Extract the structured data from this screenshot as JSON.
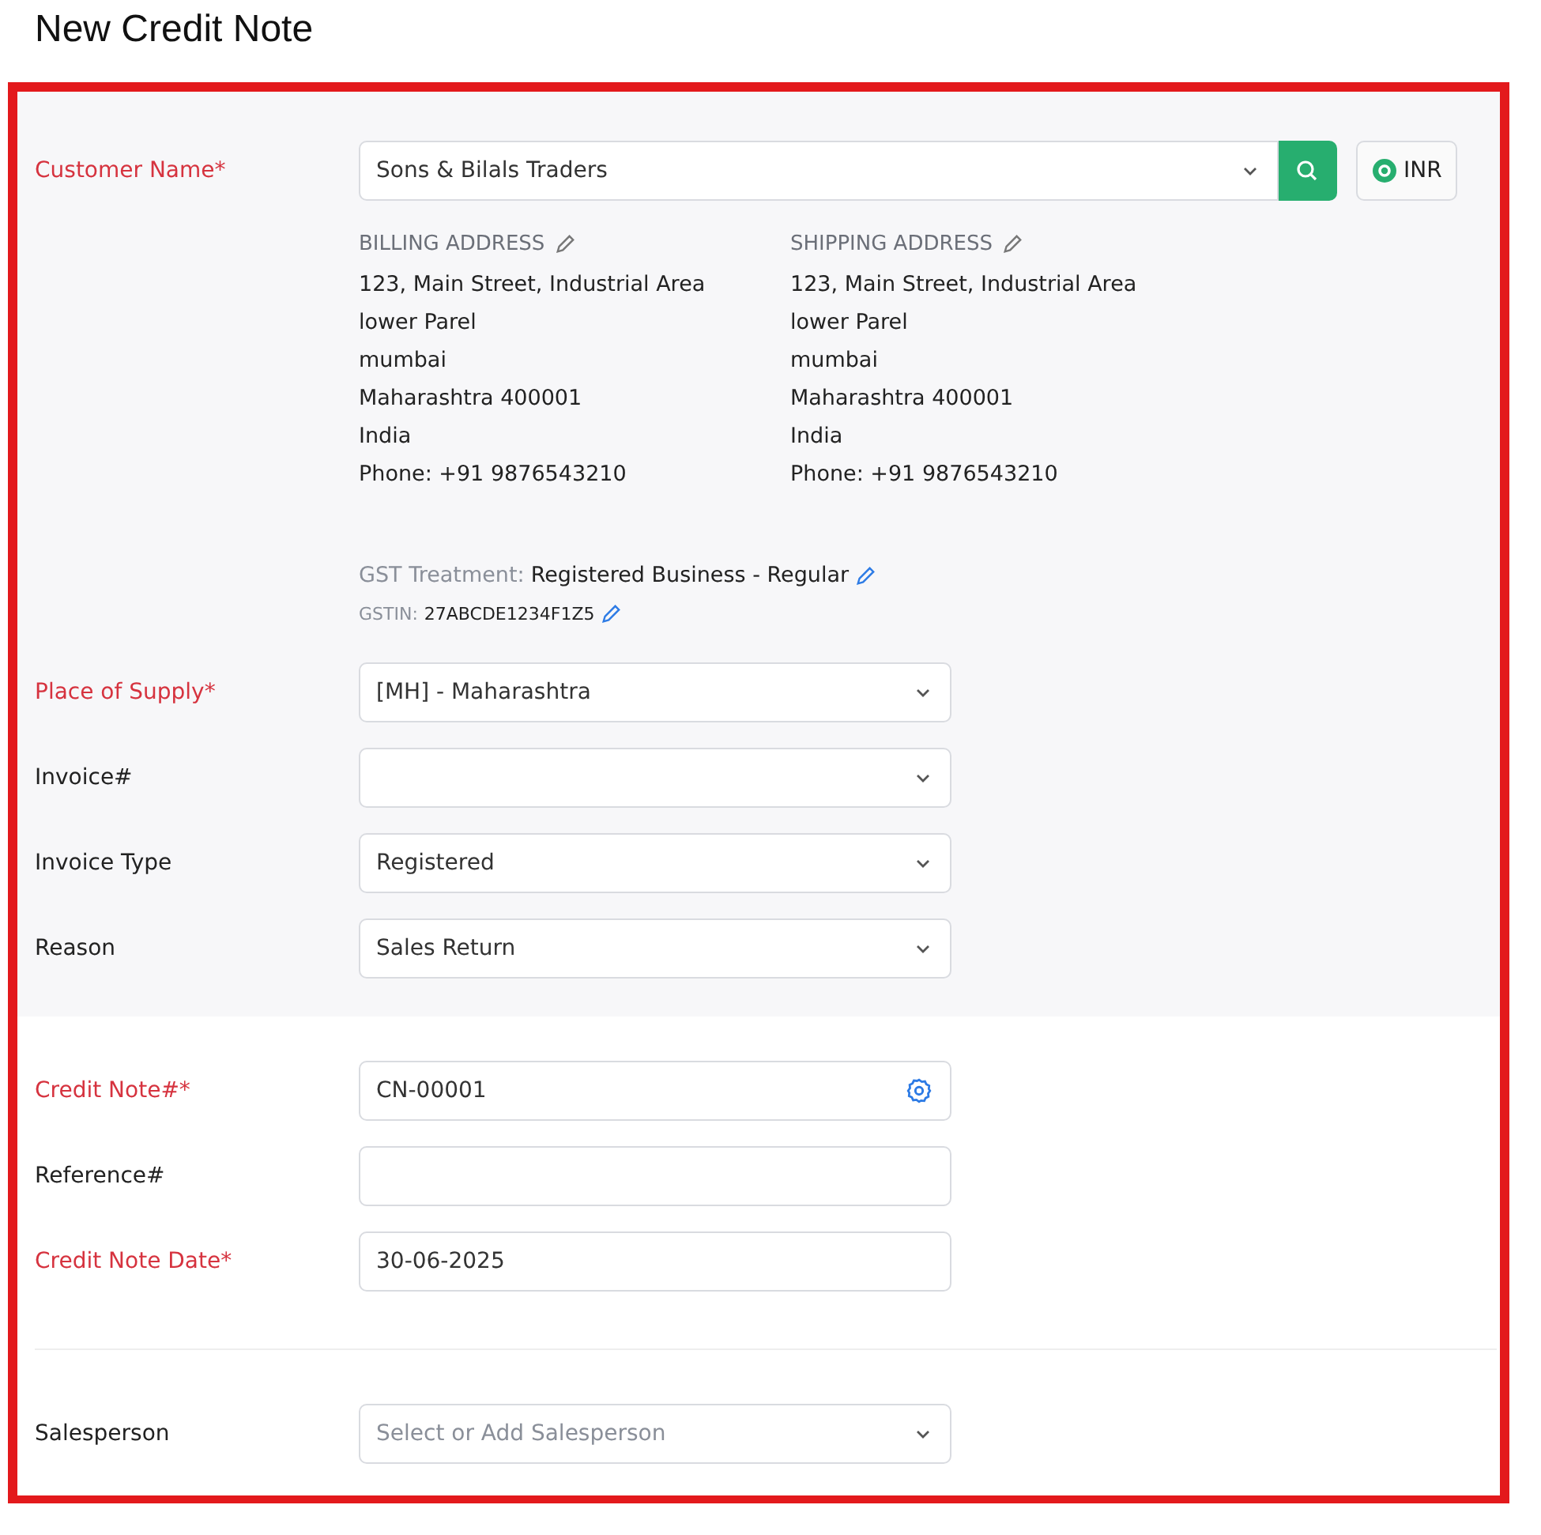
{
  "page": {
    "title": "New Credit Note"
  },
  "customer": {
    "label": "Customer Name*",
    "required": true,
    "value": "Sons & Bilals Traders",
    "currency": "INR"
  },
  "addresses": [
    {
      "heading": "BILLING ADDRESS",
      "lines": [
        "123, Main Street, Industrial Area",
        "lower Parel",
        "mumbai",
        "Maharashtra 400001",
        "India",
        "Phone: +91 9876543210"
      ]
    },
    {
      "heading": "SHIPPING ADDRESS",
      "lines": [
        "123, Main Street, Industrial Area",
        "lower Parel",
        "mumbai",
        "Maharashtra 400001",
        "India",
        "Phone: +91 9876543210"
      ]
    }
  ],
  "gst": {
    "treatment_label": "GST Treatment:",
    "treatment": "Registered Business - Regular",
    "gstin_label": "GSTIN:",
    "gstin": "27ABCDE1234F1Z5"
  },
  "section_1": [
    {
      "label": "Place of Supply*",
      "required": true,
      "kind": "select",
      "value": "[MH] - Maharashtra"
    },
    {
      "label": "Invoice#",
      "required": false,
      "kind": "select"
    },
    {
      "label": "Invoice Type",
      "required": false,
      "kind": "select",
      "value": "Registered"
    },
    {
      "label": "Reason",
      "required": false,
      "kind": "select",
      "value": "Sales Return"
    }
  ],
  "section_2": [
    {
      "label": "Credit Note#*",
      "required": true,
      "kind": "auto_number",
      "value": "CN-00001"
    },
    {
      "label": "Reference#",
      "required": false,
      "kind": "text"
    },
    {
      "label": "Credit Note Date*",
      "required": true,
      "kind": "text",
      "value": "30-06-2025"
    }
  ],
  "section_3": [
    {
      "label": "Salesperson",
      "required": false,
      "kind": "select",
      "placeholder": "Select or Add Salesperson"
    }
  ]
}
